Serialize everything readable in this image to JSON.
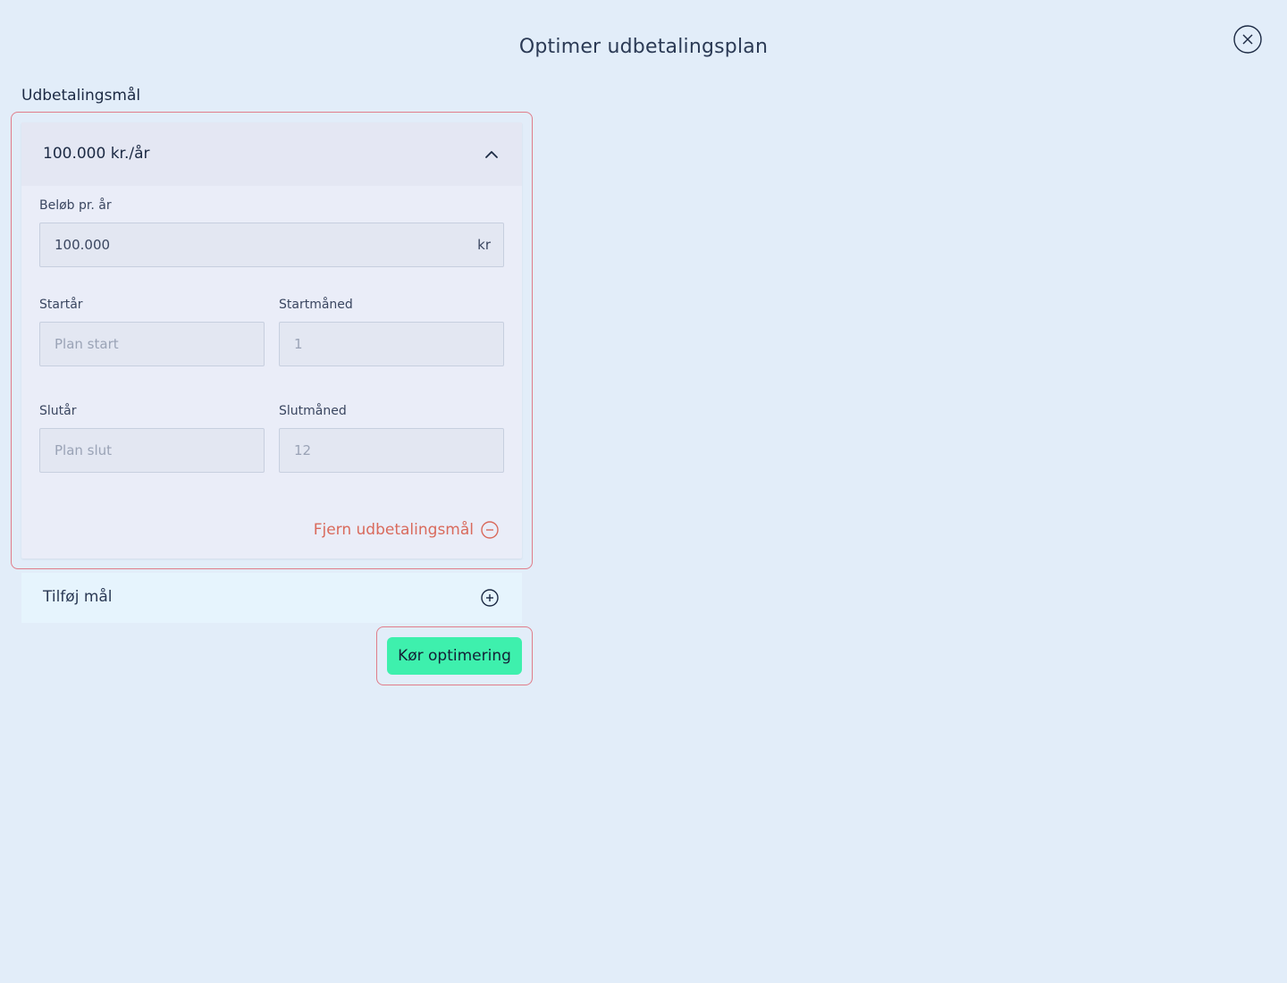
{
  "modal": {
    "title": "Optimer udbetalingsplan"
  },
  "goals_section": {
    "label": "Udbetalingsmål"
  },
  "goal": {
    "header": "100.000 kr./år",
    "amount": {
      "label": "Beløb pr. år",
      "value": "100.000",
      "suffix": "kr"
    },
    "start_year": {
      "label": "Startår",
      "placeholder": "Plan start"
    },
    "start_month": {
      "label": "Startmåned",
      "value": "1"
    },
    "end_year": {
      "label": "Slutår",
      "placeholder": "Plan slut"
    },
    "end_month": {
      "label": "Slutmåned",
      "value": "12"
    },
    "remove_label": "Fjern udbetalingsmål"
  },
  "add_goal": {
    "label": "Tilføj mål"
  },
  "run_button": {
    "label": "Kør optimering"
  },
  "colors": {
    "background": "#e2edf9",
    "accent_button": "#3ef0ad",
    "remove_red": "#d96a5c",
    "highlight_outline": "#e07d8a"
  },
  "icons": {
    "close": "close-circle-icon",
    "collapse": "chevron-up-icon",
    "remove": "minus-circle-icon",
    "add": "plus-circle-icon"
  }
}
